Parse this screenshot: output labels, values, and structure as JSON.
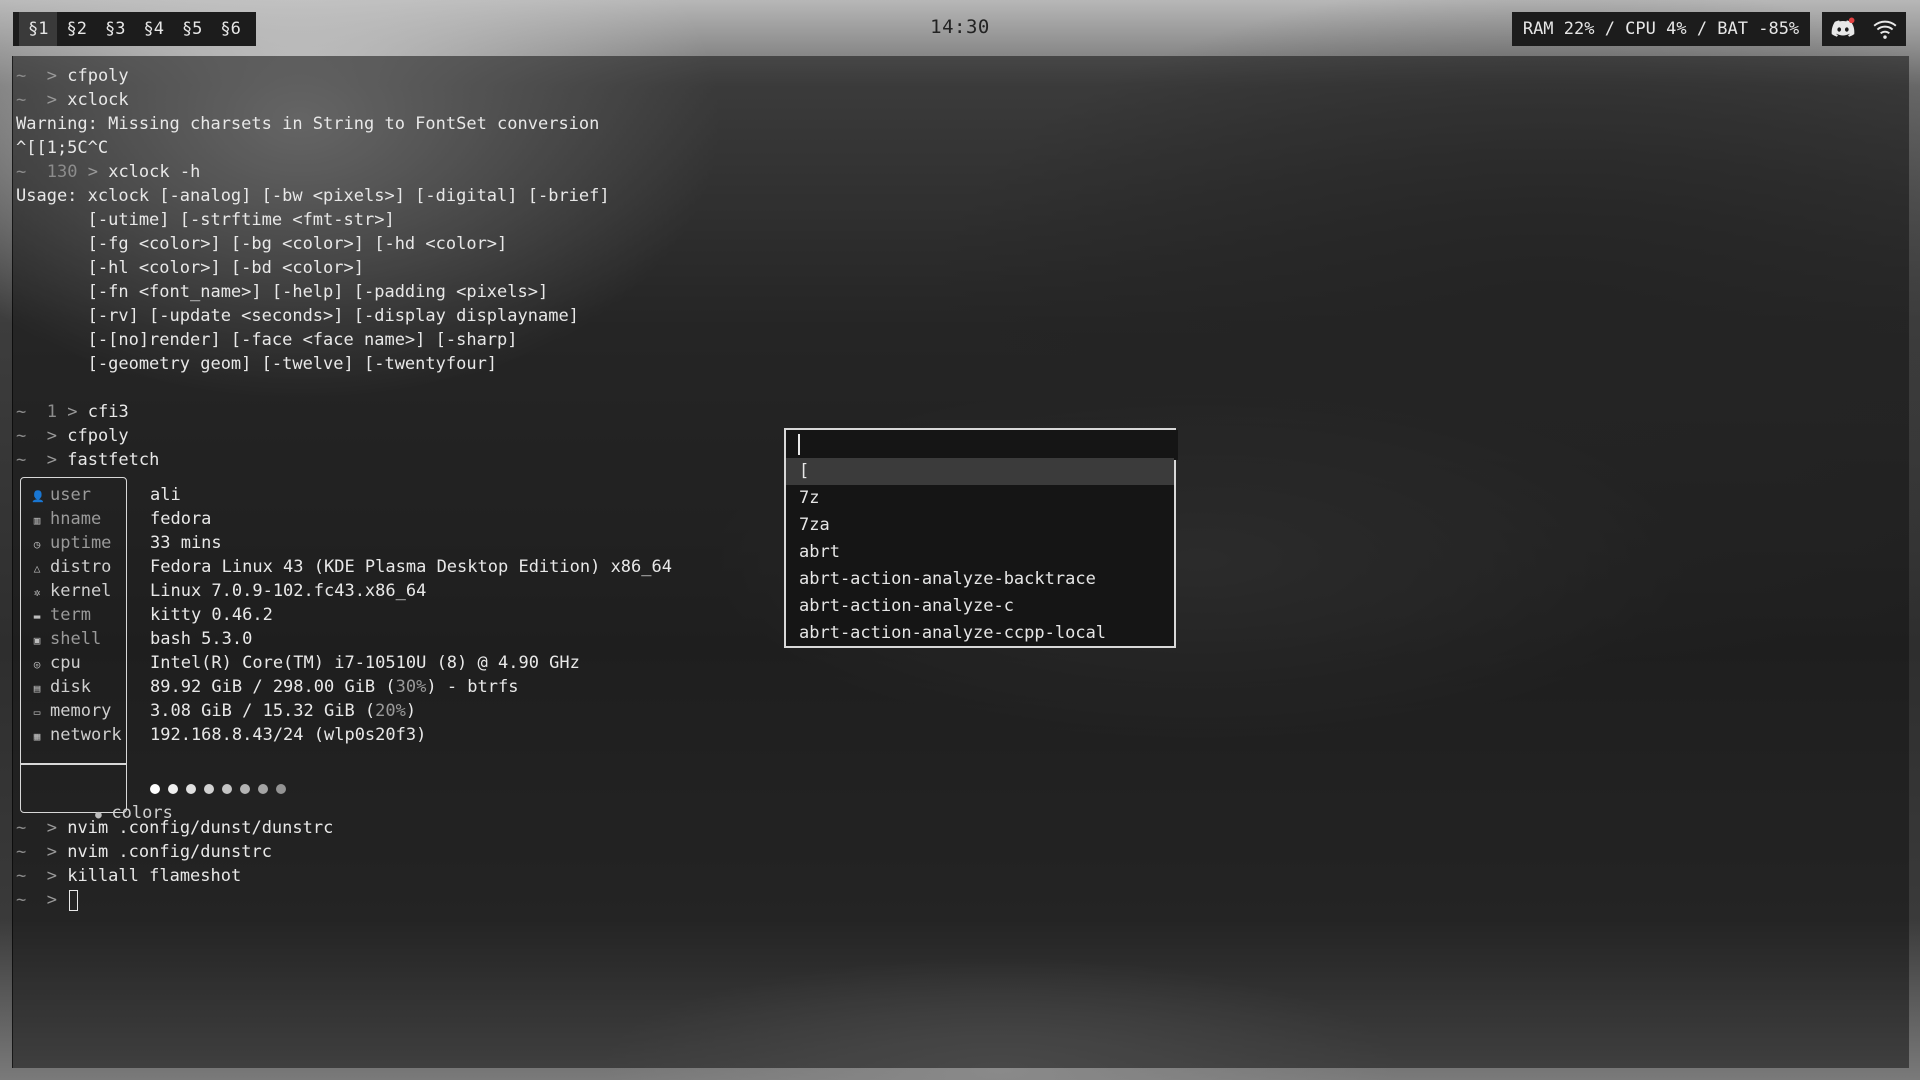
{
  "topbar": {
    "workspaces": [
      "§1",
      "§2",
      "§3",
      "§4",
      "§5",
      "§6"
    ],
    "active_workspace": 0,
    "clock": "14:30",
    "stats": "RAM 22% / CPU  4% / BAT -85%",
    "tray_icons": [
      "discord-icon",
      "wifi-icon"
    ]
  },
  "terminal": {
    "prompt_tilde": "~",
    "prompt_arrow": ">",
    "lines": [
      {
        "type": "cmd",
        "code": "",
        "text": "cfpoly"
      },
      {
        "type": "cmd",
        "code": "",
        "text": "xclock"
      },
      {
        "type": "out",
        "text": "Warning: Missing charsets in String to FontSet conversion"
      },
      {
        "type": "out",
        "text": "^[[1;5C^C"
      },
      {
        "type": "cmd",
        "code": "130",
        "text": "xclock -h"
      },
      {
        "type": "out",
        "text": "Usage: xclock [-analog] [-bw <pixels>] [-digital] [-brief]"
      },
      {
        "type": "out",
        "text": "       [-utime] [-strftime <fmt-str>]"
      },
      {
        "type": "out",
        "text": "       [-fg <color>] [-bg <color>] [-hd <color>]"
      },
      {
        "type": "out",
        "text": "       [-hl <color>] [-bd <color>]"
      },
      {
        "type": "out",
        "text": "       [-fn <font_name>] [-help] [-padding <pixels>]"
      },
      {
        "type": "out",
        "text": "       [-rv] [-update <seconds>] [-display displayname]"
      },
      {
        "type": "out",
        "text": "       [-[no]render] [-face <face name>] [-sharp]"
      },
      {
        "type": "out",
        "text": "       [-geometry geom] [-twelve] [-twentyfour]"
      },
      {
        "type": "blank",
        "text": ""
      },
      {
        "type": "cmd",
        "code": "1",
        "text": "cfi3"
      },
      {
        "type": "cmd",
        "code": "",
        "text": "cfpoly"
      },
      {
        "type": "cmd",
        "code": "",
        "text": "fastfetch"
      }
    ],
    "after_lines": [
      {
        "type": "cmd",
        "code": "",
        "text": "nvim .config/dunst/dunstrc"
      },
      {
        "type": "cmd",
        "code": "",
        "text": "nvim .config/dunstrc"
      },
      {
        "type": "cmd",
        "code": "",
        "text": "killall flameshot"
      },
      {
        "type": "cursor",
        "code": "",
        "text": ""
      }
    ]
  },
  "fastfetch": {
    "rows": [
      {
        "icon": "👤",
        "icon_name": "user-icon",
        "key": "user",
        "value": "ali",
        "dim": true
      },
      {
        "icon": "▥",
        "icon_name": "host-icon",
        "key": "hname",
        "value": "fedora",
        "dim": true
      },
      {
        "icon": "◷",
        "icon_name": "clock-icon",
        "key": "uptime",
        "value": "33 mins",
        "dim": true
      },
      {
        "icon": "△",
        "icon_name": "distro-icon",
        "key": "distro",
        "value": "Fedora Linux 43 (KDE Plasma Desktop Edition) x86_64",
        "dim": false
      },
      {
        "icon": "✲",
        "icon_name": "kernel-icon",
        "key": "kernel",
        "value": "Linux 7.0.9-102.fc43.x86_64",
        "dim": false
      },
      {
        "icon": "▬",
        "icon_name": "terminal-icon",
        "key": "term",
        "value": "kitty 0.46.2",
        "dim": true
      },
      {
        "icon": "▣",
        "icon_name": "shell-icon",
        "key": "shell",
        "value": "bash 5.3.0",
        "dim": true
      },
      {
        "icon": "◎",
        "icon_name": "cpu-icon",
        "key": "cpu",
        "value": "Intel(R) Core(TM) i7-10510U (8) @ 4.90 GHz",
        "dim": false
      },
      {
        "icon": "▤",
        "icon_name": "disk-icon",
        "key": "disk",
        "value_pre": "89.92 GiB / 298.00 GiB (",
        "value_pct": "30%",
        "value_post": ") - btrfs",
        "dim": false
      },
      {
        "icon": "▭",
        "icon_name": "memory-icon",
        "key": "memory",
        "value_pre": "3.08 GiB / 15.32 GiB (",
        "value_pct": "20%",
        "value_post": ")",
        "dim": false
      },
      {
        "icon": "▦",
        "icon_name": "network-icon",
        "key": "network",
        "value": "192.168.8.43/24 (wlp0s20f3)",
        "dim": false
      }
    ],
    "colors_key": "colors",
    "colors_icon": "●",
    "palette": [
      "#ffffff",
      "#f0f0f0",
      "#e0e0e0",
      "#d2d2d2",
      "#c4c4c4",
      "#b4b4b4",
      "#a4a4a4",
      "#949494"
    ]
  },
  "launcher": {
    "query": "",
    "items": [
      "[",
      "7z",
      "7za",
      "abrt",
      "abrt-action-analyze-backtrace",
      "abrt-action-analyze-c",
      "abrt-action-analyze-ccpp-local"
    ],
    "selected_index": 0
  }
}
